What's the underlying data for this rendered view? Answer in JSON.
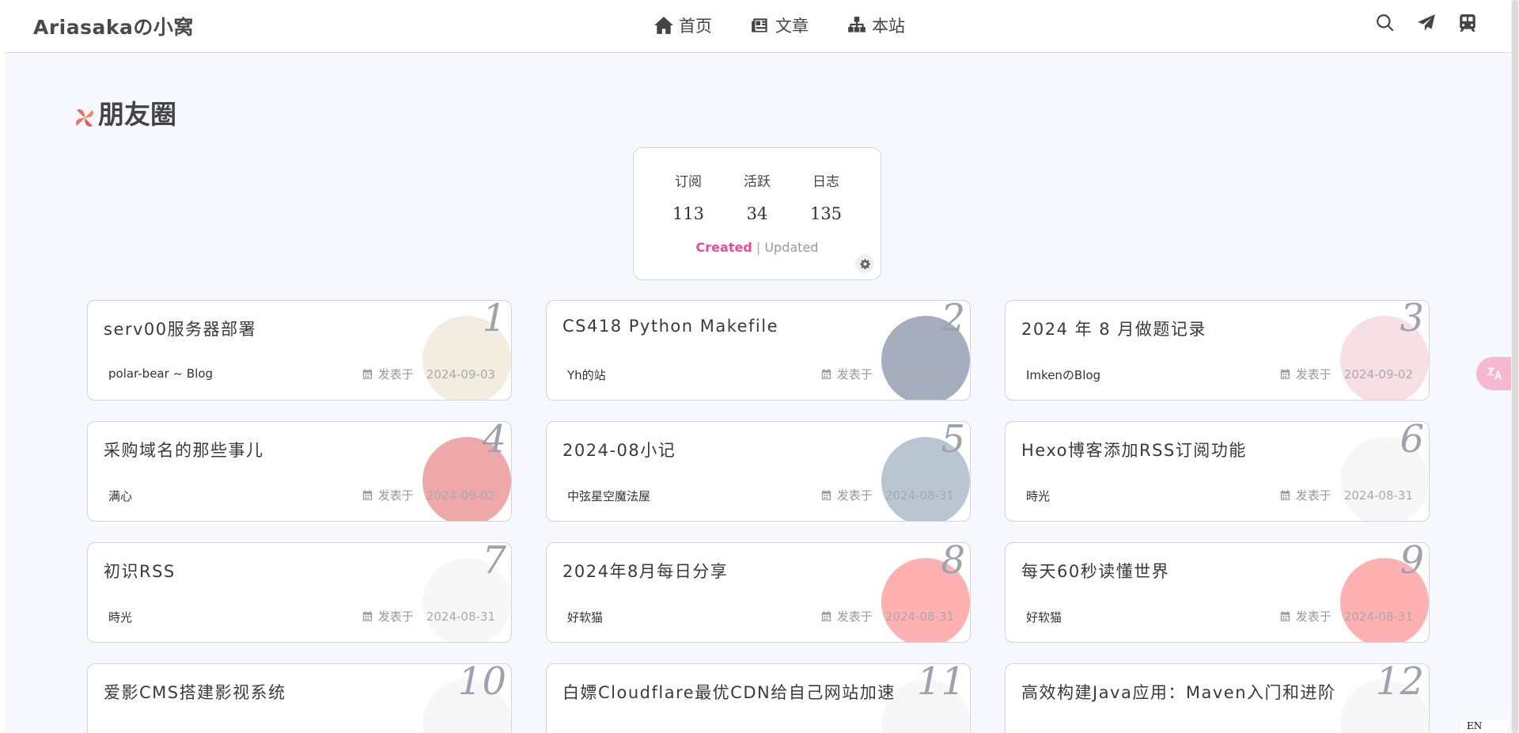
{
  "header": {
    "site_title": "Ariasakaの小窝",
    "nav": [
      {
        "label": "首页",
        "icon": "home-icon"
      },
      {
        "label": "文章",
        "icon": "newspaper-icon"
      },
      {
        "label": "本站",
        "icon": "sitemap-icon"
      }
    ],
    "tools": [
      "search-icon",
      "paper-plane-icon",
      "train-icon"
    ]
  },
  "page": {
    "heading": "朋友圈",
    "heading_icon": "pinwheel-icon"
  },
  "stats": {
    "subscribe_label": "订阅",
    "subscribe_value": "113",
    "active_label": "活跃",
    "active_value": "34",
    "log_label": "日志",
    "log_value": "135",
    "sort_created": "Created",
    "sort_sep": "|",
    "sort_updated": "Updated"
  },
  "meta_label": "发表于",
  "accent_color": "#ef4a91",
  "cards": [
    {
      "num": "1",
      "title": "serv00服务器部署",
      "author": "polar-bear ~ Blog",
      "date": "2024-09-03",
      "avatar_color": "#e9dcc6"
    },
    {
      "num": "2",
      "title": "CS418 Python Makefile",
      "author": "Yh的站",
      "date": "2024-09-02",
      "avatar_color": "#5d6a8a"
    },
    {
      "num": "3",
      "title": "2024 年 8 月做题记录",
      "author": "ImkenのBlog",
      "date": "2024-09-02",
      "avatar_color": "#f3c3cf"
    },
    {
      "num": "4",
      "title": "采购域名的那些事儿",
      "author": "满心",
      "date": "2024-09-02",
      "avatar_color": "#e06060"
    },
    {
      "num": "5",
      "title": "2024-08小记",
      "author": "中弦星空魔法屋",
      "date": "2024-08-31",
      "avatar_color": "#7f97ad"
    },
    {
      "num": "6",
      "title": "Hexo博客添加RSS订阅功能",
      "author": "時光",
      "date": "2024-08-31",
      "avatar_color": "#f0f0f0"
    },
    {
      "num": "7",
      "title": "初识RSS",
      "author": "時光",
      "date": "2024-08-31",
      "avatar_color": "#f0f0f0"
    },
    {
      "num": "8",
      "title": "2024年8月每日分享",
      "author": "好软猫",
      "date": "2024-08-31",
      "avatar_color": "#ff6f6f"
    },
    {
      "num": "9",
      "title": "每天60秒读懂世界",
      "author": "好软猫",
      "date": "2024-08-31",
      "avatar_color": "#ff6f6f"
    },
    {
      "num": "10",
      "title": "爱影CMS搭建影视系统",
      "author": "",
      "date": "",
      "avatar_color": "#f0f0f0"
    },
    {
      "num": "11",
      "title": "白嫖Cloudflare最优CDN给自己网站加速",
      "author": "",
      "date": "",
      "avatar_color": "#f0f0f0"
    },
    {
      "num": "12",
      "title": "高效构建Java应用：Maven入门和进阶",
      "author": "",
      "date": "",
      "avatar_color": "#f0f0f0"
    }
  ],
  "float_button_icon": "translate-icon",
  "lang_label": "EN"
}
